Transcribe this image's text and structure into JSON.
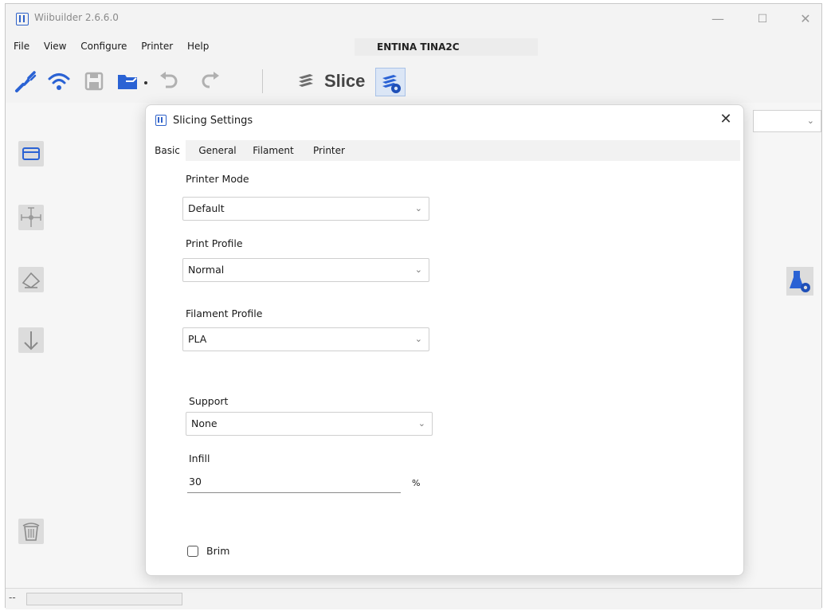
{
  "window": {
    "title": "Wiibuilder 2.6.6.0",
    "controls": {
      "minimize": "—",
      "maximize": "☐",
      "close": "✕"
    }
  },
  "menu": [
    "File",
    "View",
    "Configure",
    "Printer",
    "Help"
  ],
  "printer_name": "ENTINA TINA2C",
  "toolbar": {
    "icons": [
      "connect-icon",
      "wifi-icon",
      "save-icon",
      "open-folder-icon",
      "dropdown-arrow-icon",
      "undo-icon",
      "redo-icon",
      "slice-layers-icon",
      "slicing-settings-icon"
    ],
    "slice_label": "Slice"
  },
  "left_tools": [
    "platform-icon",
    "move-icon",
    "rotate-icon",
    "lay-flat-icon",
    "delete-icon"
  ],
  "statusbar": {
    "text": "--"
  },
  "dialog": {
    "title": "Slicing Settings",
    "close": "✕",
    "tabs": [
      "Basic",
      "General",
      "Filament",
      "Printer"
    ],
    "active_tab": "Basic",
    "fields": {
      "printer_mode": {
        "label": "Printer Mode",
        "value": "Default"
      },
      "print_profile": {
        "label": "Print Profile",
        "value": "Normal"
      },
      "filament_profile": {
        "label": "Filament Profile",
        "value": "PLA"
      },
      "support": {
        "label": "Support",
        "value": "None"
      },
      "infill": {
        "label": "Infill",
        "value": "30",
        "unit": "%"
      },
      "brim": {
        "label": "Brim",
        "checked": false
      }
    }
  },
  "colors": {
    "accent": "#2f62c9",
    "toolbar_icon": "#2a62d4",
    "slice_grey": "#6e6e6e"
  }
}
